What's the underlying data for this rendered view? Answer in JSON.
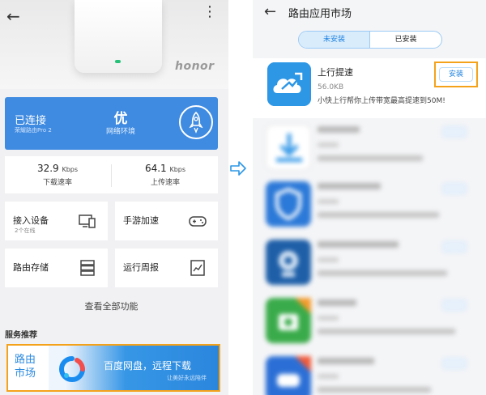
{
  "left_screen": {
    "brand": "honor",
    "status": {
      "connection": "已连接",
      "router_name": "荣耀路由Pro 2",
      "quality": "优",
      "quality_label": "网络环境"
    },
    "speeds": [
      {
        "value": "32.9",
        "unit": "Kbps",
        "label": "下载速率"
      },
      {
        "value": "64.1",
        "unit": "Kbps",
        "label": "上传速率"
      }
    ],
    "tiles": [
      {
        "title": "接入设备",
        "sub": "2个在线",
        "icon": "devices-icon"
      },
      {
        "title": "手游加速",
        "sub": "",
        "icon": "gamepad-icon"
      },
      {
        "title": "路由存储",
        "sub": "",
        "icon": "storage-icon"
      },
      {
        "title": "运行周报",
        "sub": "",
        "icon": "report-icon"
      }
    ],
    "view_all": "查看全部功能",
    "section_title": "服务推荐",
    "banner": {
      "market_line1": "路由",
      "market_line2": "市场",
      "title": "百度网盘，远程下载",
      "subtitle": "让美好永远陪伴"
    }
  },
  "right_screen": {
    "title": "路由应用市场",
    "tabs": [
      "未安装",
      "已安装"
    ],
    "active_tab": "未安装",
    "featured_app": {
      "name": "上行提速",
      "size": "56.0KB",
      "description": "小快上行帮你上传带宽最高提速到50M!",
      "install_label": "安装"
    },
    "other_apps_blurred": 5
  },
  "colors": {
    "status_blue": "#3f8be1",
    "accent_blue": "#1e82e0",
    "highlight_orange": "#f5a21b"
  }
}
